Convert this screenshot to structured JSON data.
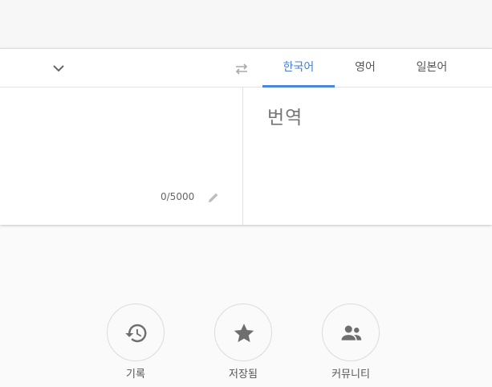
{
  "lang_tabs": [
    {
      "label": "한국어",
      "active": true
    },
    {
      "label": "영어",
      "active": false
    },
    {
      "label": "일본어",
      "active": false
    }
  ],
  "source": {
    "char_count": "0/5000"
  },
  "target": {
    "placeholder": "번역"
  },
  "actions": [
    {
      "label": "기록",
      "icon": "history-icon"
    },
    {
      "label": "저장됨",
      "icon": "star-icon"
    },
    {
      "label": "커뮤니티",
      "icon": "community-icon"
    }
  ],
  "colors": {
    "accent": "#4a86e0",
    "background": "#fafafa",
    "icon": "#757575"
  }
}
